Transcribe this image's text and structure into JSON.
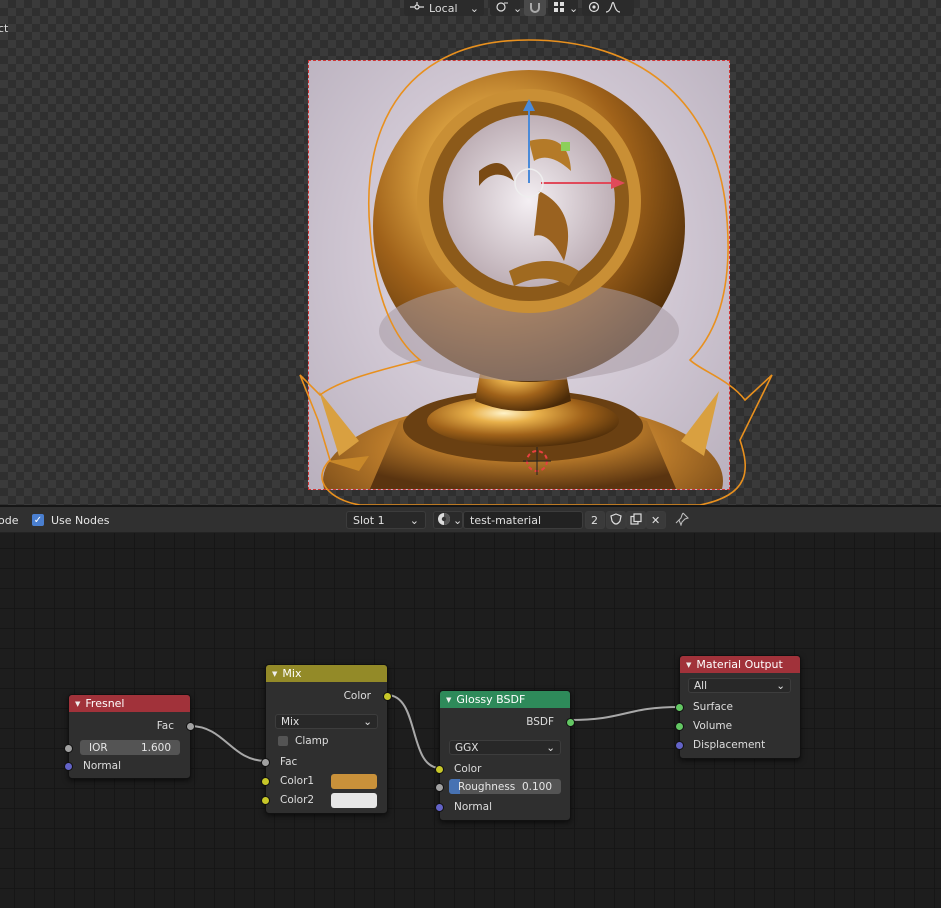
{
  "viewport": {
    "header": {
      "pivot_label": "Local",
      "mode_text_fragment": "ct"
    },
    "icons": [
      "transform-orientation-icon",
      "snap-icon",
      "magnet-icon",
      "proportional-icon",
      "overlay-icon",
      "falloff-icon"
    ]
  },
  "node_editor": {
    "header": {
      "mode_fragment": "ode",
      "use_nodes_label": "Use Nodes",
      "use_nodes_checked": true,
      "slot_label": "Slot 1",
      "material_name": "test-material",
      "user_count": "2"
    },
    "nodes": {
      "fresnel": {
        "title": "Fresnel",
        "header_color": "#a1323a",
        "output_fac": "Fac",
        "ior_label": "IOR",
        "ior_value": "1.600",
        "input_normal": "Normal"
      },
      "mix": {
        "title": "Mix",
        "header_color": "#938a28",
        "output_color": "Color",
        "blend_mode": "Mix",
        "clamp_label": "Clamp",
        "clamp_checked": false,
        "input_fac": "Fac",
        "input_color1": "Color1",
        "input_color2": "Color2",
        "color1_swatch": "#c9913a",
        "color2_swatch": "#e6e6e6"
      },
      "glossy": {
        "title": "Glossy BSDF",
        "header_color": "#2e8a5a",
        "output_bsdf": "BSDF",
        "distribution": "GGX",
        "input_color": "Color",
        "roughness_label": "Roughness",
        "roughness_value": "0.100",
        "roughness_fraction": 0.1,
        "input_normal": "Normal"
      },
      "output": {
        "title": "Material Output",
        "header_color": "#a1323a",
        "target": "All",
        "input_surface": "Surface",
        "input_volume": "Volume",
        "input_displacement": "Displacement"
      }
    }
  }
}
